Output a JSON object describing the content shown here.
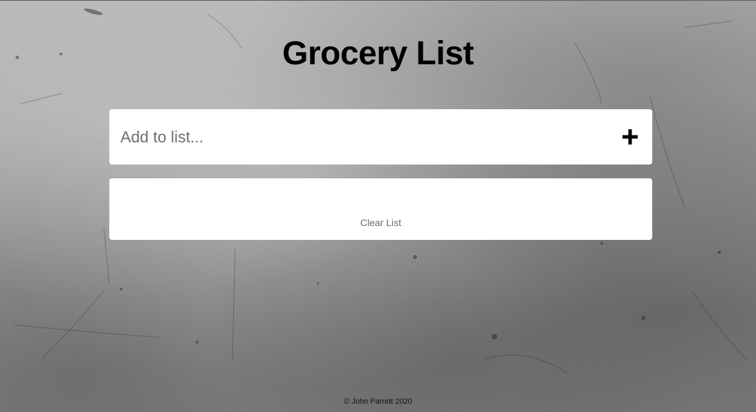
{
  "page": {
    "title": "Grocery List"
  },
  "add_form": {
    "placeholder": "Add to list...",
    "value": "",
    "add_icon": "plus-icon"
  },
  "list": {
    "items": [],
    "clear_label": "Clear List"
  },
  "footer": {
    "text": "© John Parrett 2020"
  },
  "colors": {
    "background": "#9a9a9a",
    "panel": "#ffffff",
    "title_text": "#000000",
    "placeholder_text": "#6e6e6e",
    "clear_text": "#6b6b6b"
  }
}
